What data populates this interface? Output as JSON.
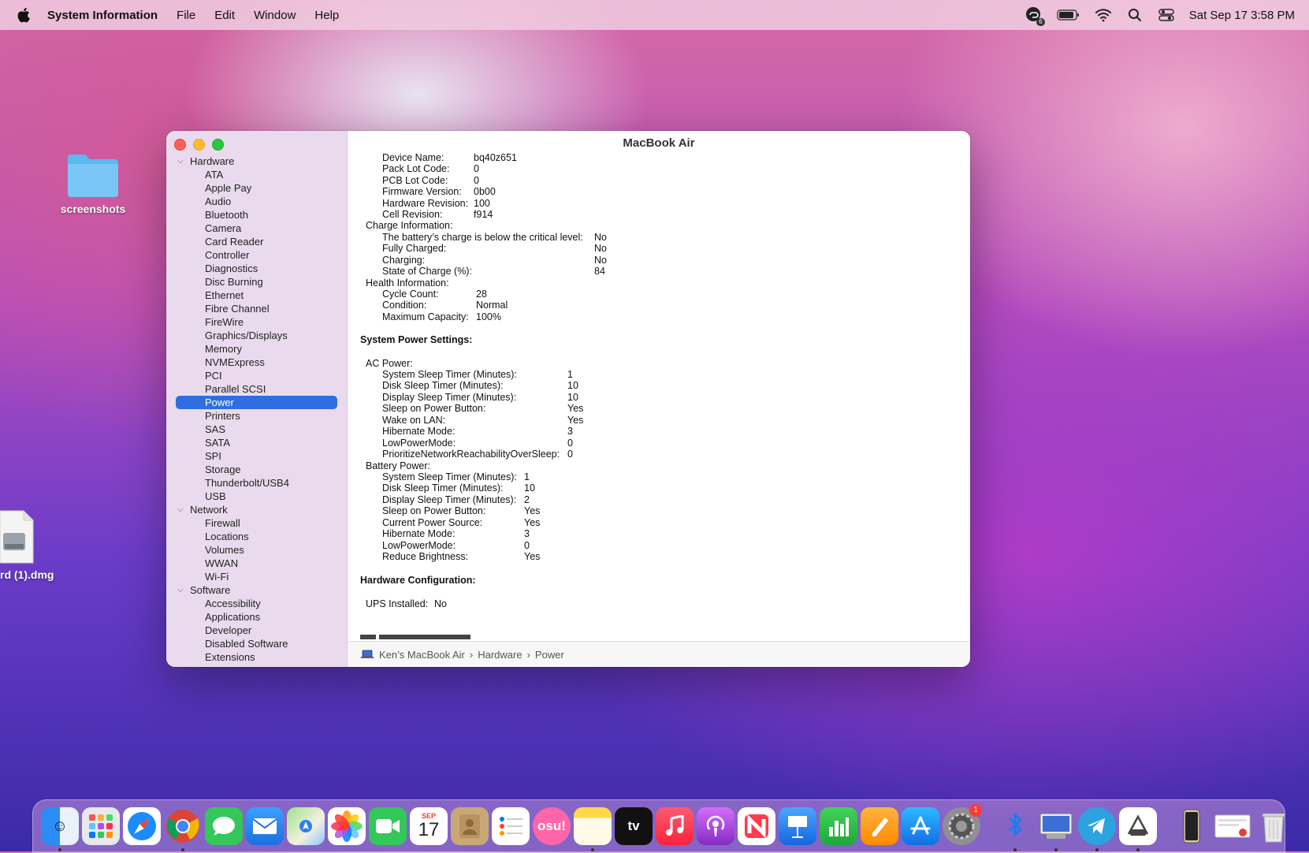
{
  "menubar": {
    "app_name": "System Information",
    "menus": [
      "File",
      "Edit",
      "Window",
      "Help"
    ],
    "badge_count": "6",
    "datetime": "Sat Sep 17  3:58 PM"
  },
  "desktop": {
    "folder_label": "screenshots",
    "dmg_label": "rd (1).dmg"
  },
  "window": {
    "title": "MacBook Air",
    "sidebar": {
      "sections": [
        {
          "label": "Hardware",
          "items": [
            "ATA",
            "Apple Pay",
            "Audio",
            "Bluetooth",
            "Camera",
            "Card Reader",
            "Controller",
            "Diagnostics",
            "Disc Burning",
            "Ethernet",
            "Fibre Channel",
            "FireWire",
            "Graphics/Displays",
            "Memory",
            "NVMExpress",
            "PCI",
            "Parallel SCSI",
            "Power",
            "Printers",
            "SAS",
            "SATA",
            "SPI",
            "Storage",
            "Thunderbolt/USB4",
            "USB"
          ]
        },
        {
          "label": "Network",
          "items": [
            "Firewall",
            "Locations",
            "Volumes",
            "WWAN",
            "Wi-Fi"
          ]
        },
        {
          "label": "Software",
          "items": [
            "Accessibility",
            "Applications",
            "Developer",
            "Disabled Software",
            "Extensions"
          ]
        }
      ],
      "selected": "Power"
    },
    "report": {
      "battery_model": [
        {
          "k": "Device Name:",
          "v": "bq40z651"
        },
        {
          "k": "Pack Lot Code:",
          "v": "0"
        },
        {
          "k": "PCB Lot Code:",
          "v": "0"
        },
        {
          "k": "Firmware Version:",
          "v": "0b00"
        },
        {
          "k": "Hardware Revision:",
          "v": "100"
        },
        {
          "k": "Cell Revision:",
          "v": "f914"
        }
      ],
      "charge_header": "Charge Information:",
      "charge": [
        {
          "k": "The battery’s charge is below the critical level:",
          "v": "No"
        },
        {
          "k": "Fully Charged:",
          "v": "No"
        },
        {
          "k": "Charging:",
          "v": "No"
        },
        {
          "k": "State of Charge (%):",
          "v": "84"
        }
      ],
      "health_header": "Health Information:",
      "health": [
        {
          "k": "Cycle Count:",
          "v": "28"
        },
        {
          "k": "Condition:",
          "v": "Normal"
        },
        {
          "k": "Maximum Capacity:",
          "v": "100%"
        }
      ],
      "power_settings_header": "System Power Settings:",
      "ac_header": "AC Power:",
      "ac": [
        {
          "k": "System Sleep Timer (Minutes):",
          "v": "1"
        },
        {
          "k": "Disk Sleep Timer (Minutes):",
          "v": "10"
        },
        {
          "k": "Display Sleep Timer (Minutes):",
          "v": "10"
        },
        {
          "k": "Sleep on Power Button:",
          "v": "Yes"
        },
        {
          "k": "Wake on LAN:",
          "v": "Yes"
        },
        {
          "k": "Hibernate Mode:",
          "v": "3"
        },
        {
          "k": "LowPowerMode:",
          "v": "0"
        },
        {
          "k": "PrioritizeNetworkReachabilityOverSleep:",
          "v": "0"
        }
      ],
      "battery_header": "Battery Power:",
      "battery": [
        {
          "k": "System Sleep Timer (Minutes):",
          "v": "1"
        },
        {
          "k": "Disk Sleep Timer (Minutes):",
          "v": "10"
        },
        {
          "k": "Display Sleep Timer (Minutes):",
          "v": "2"
        },
        {
          "k": "Sleep on Power Button:",
          "v": "Yes"
        },
        {
          "k": "Current Power Source:",
          "v": "Yes"
        },
        {
          "k": "Hibernate Mode:",
          "v": "3"
        },
        {
          "k": "LowPowerMode:",
          "v": "0"
        },
        {
          "k": "Reduce Brightness:",
          "v": "Yes"
        }
      ],
      "hw_config_header": "Hardware Configuration:",
      "ups_label": "UPS Installed:",
      "ups_value": "No"
    },
    "pathbar": [
      "Ken’s MacBook Air",
      "Hardware",
      "Power"
    ]
  },
  "dock": {
    "settings_badge": "1",
    "calendar_month": "SEP",
    "calendar_day": "17",
    "osu_label": "osu!",
    "tv_label": "tv"
  }
}
